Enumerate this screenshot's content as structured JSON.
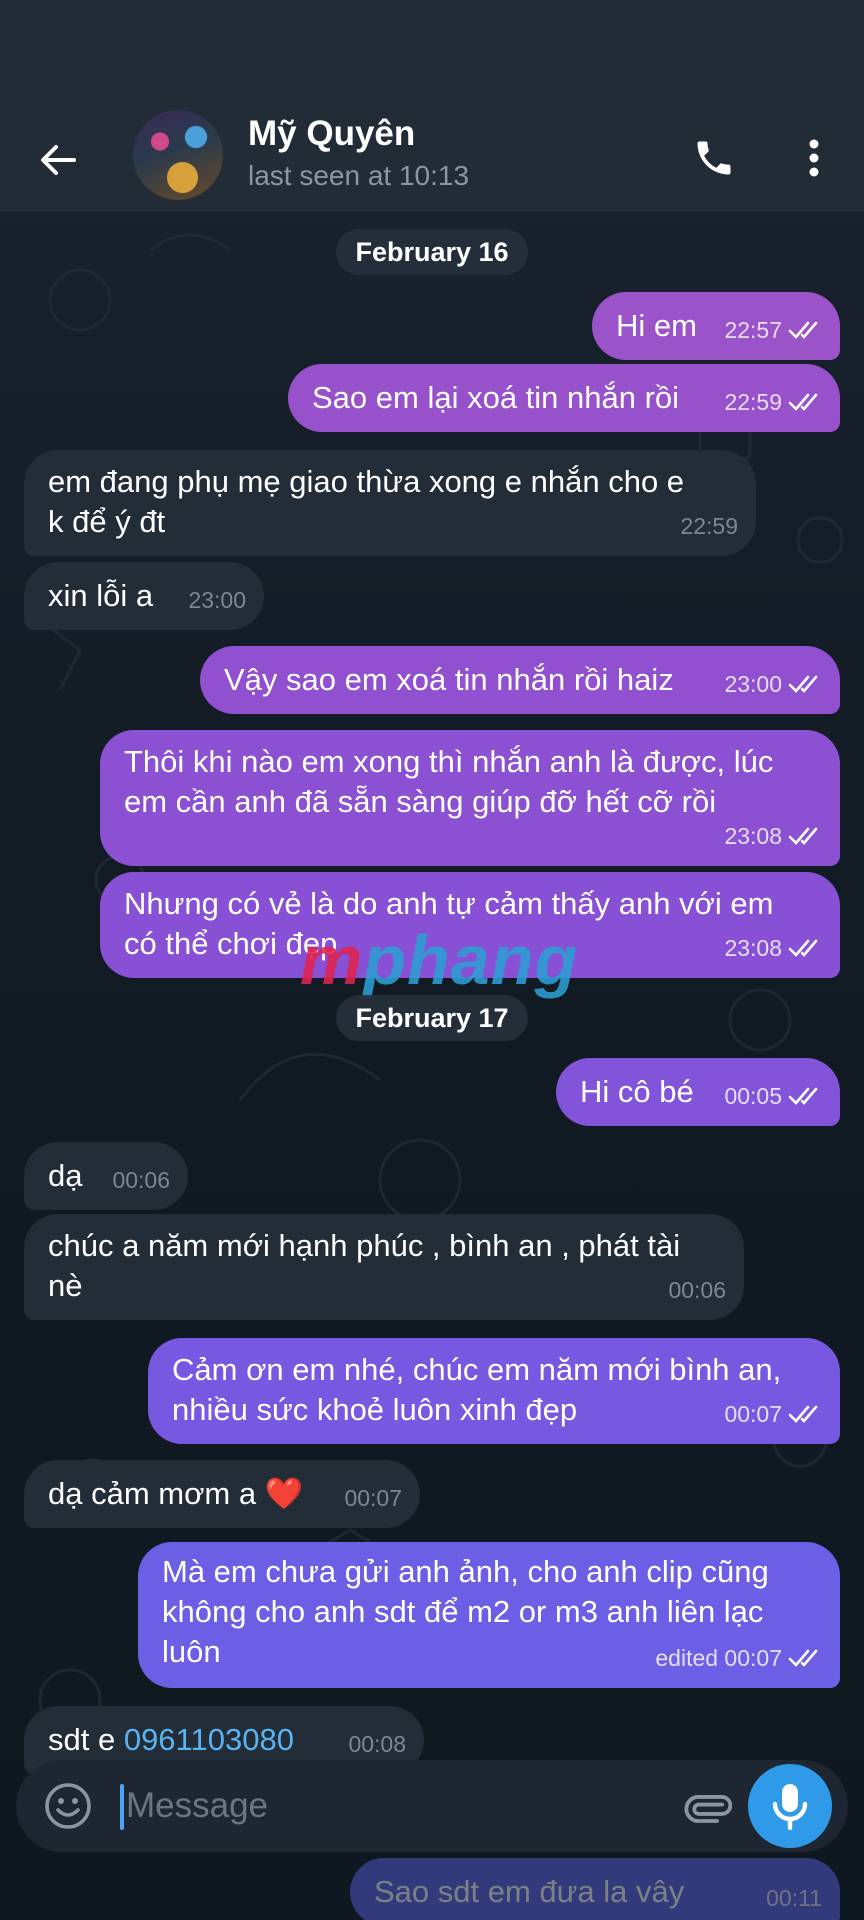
{
  "header": {
    "name": "Mỹ Quyên",
    "status": "last seen at 10:13"
  },
  "dates": [
    "February 16",
    "February 17"
  ],
  "messages": [
    {
      "dir": "out",
      "text": "Hi em",
      "time": "22:57",
      "read": true
    },
    {
      "dir": "out",
      "text": "Sao em lại xoá tin nhắn rồi",
      "time": "22:59",
      "read": true
    },
    {
      "dir": "in",
      "lines": [
        "em đang phụ mẹ giao thừa xong e nhắn cho e",
        "k để ý đt"
      ],
      "time": "22:59"
    },
    {
      "dir": "in",
      "text": "xin lỗi a",
      "time": "23:00"
    },
    {
      "dir": "out",
      "text": "Vậy sao em xoá tin nhắn rồi haiz",
      "time": "23:00",
      "read": true
    },
    {
      "dir": "out",
      "lines": [
        "Thôi khi nào em xong thì nhắn anh là được, lúc",
        "em cần anh đã sẵn sàng giúp đỡ hết cỡ rồi"
      ],
      "time": "23:08",
      "read": true
    },
    {
      "dir": "out",
      "lines": [
        "Nhưng có vẻ là do anh tự cảm thấy anh với em",
        "có thể chơi đẹp"
      ],
      "time": "23:08",
      "read": true
    },
    {
      "dir": "out",
      "text": "Hi cô bé",
      "time": "00:05",
      "read": true
    },
    {
      "dir": "in",
      "text": "dạ",
      "time": "00:06"
    },
    {
      "dir": "in",
      "lines": [
        "chúc a năm mới hạnh phúc , bình an , phát tài",
        "nè"
      ],
      "time": "00:06"
    },
    {
      "dir": "out",
      "lines": [
        "Cảm ơn em nhé, chúc em năm mới bình an,",
        "nhiều sức khoẻ luôn xinh đẹp"
      ],
      "time": "00:07",
      "read": true
    },
    {
      "dir": "in",
      "text": "dạ cảm mơm a",
      "emoji": "❤️",
      "time": "00:07"
    },
    {
      "dir": "out",
      "lines": [
        "Mà em chưa gửi anh ảnh, cho anh clip cũng",
        "không cho anh sdt để m2 or m3 anh liên lạc",
        "luôn"
      ],
      "time": "edited 00:07",
      "read": true
    },
    {
      "dir": "in",
      "text": "sdt e ",
      "link": "0961103080",
      "time": "00:08"
    },
    {
      "dir": "out",
      "text": "Sao sdt em đưa la vây",
      "time": "00:11",
      "read": true
    }
  ],
  "watermark": {
    "part1": "m",
    "part2": "phang"
  },
  "composer": {
    "placeholder": "Message"
  },
  "icons": {
    "back": "arrow-left-icon",
    "call": "phone-icon",
    "menu": "more-vertical-icon",
    "emoji": "smile-icon",
    "attach": "paperclip-icon",
    "mic": "microphone-icon"
  },
  "colors": {
    "header_bg": "#222c37",
    "incoming_bubble": "#222d38",
    "outgoing_top": "#9b52c8",
    "outgoing_bottom": "#6a62e6",
    "link": "#5ab3f0",
    "mic_button": "#2f9be8"
  }
}
